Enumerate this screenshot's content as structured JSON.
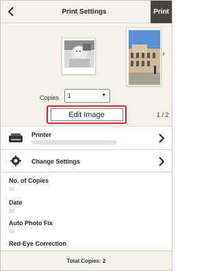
{
  "header": {
    "title": "Print Settings",
    "print_label": "Print",
    "back_icon": "back-arrow-icon"
  },
  "preview": {
    "copies_label": "Copies",
    "copies_value": "1",
    "edit_label": "Edit Image",
    "page_indicator": "1 / 2"
  },
  "printer_row": {
    "title": "Printer",
    "icon": "printer-icon"
  },
  "settings_row": {
    "title": "Change Settings",
    "icon": "gear-icon"
  },
  "settings": [
    {
      "label": "No. of Copies"
    },
    {
      "label": "Date"
    },
    {
      "label": "Auto Photo Fix"
    },
    {
      "label": "Red-Eye Correction"
    }
  ],
  "footer": {
    "total_label": "Total Copies: 2"
  },
  "colors": {
    "header_bg": "#f4f1ea",
    "print_button": "#4a4440",
    "highlight": "#e02020"
  }
}
